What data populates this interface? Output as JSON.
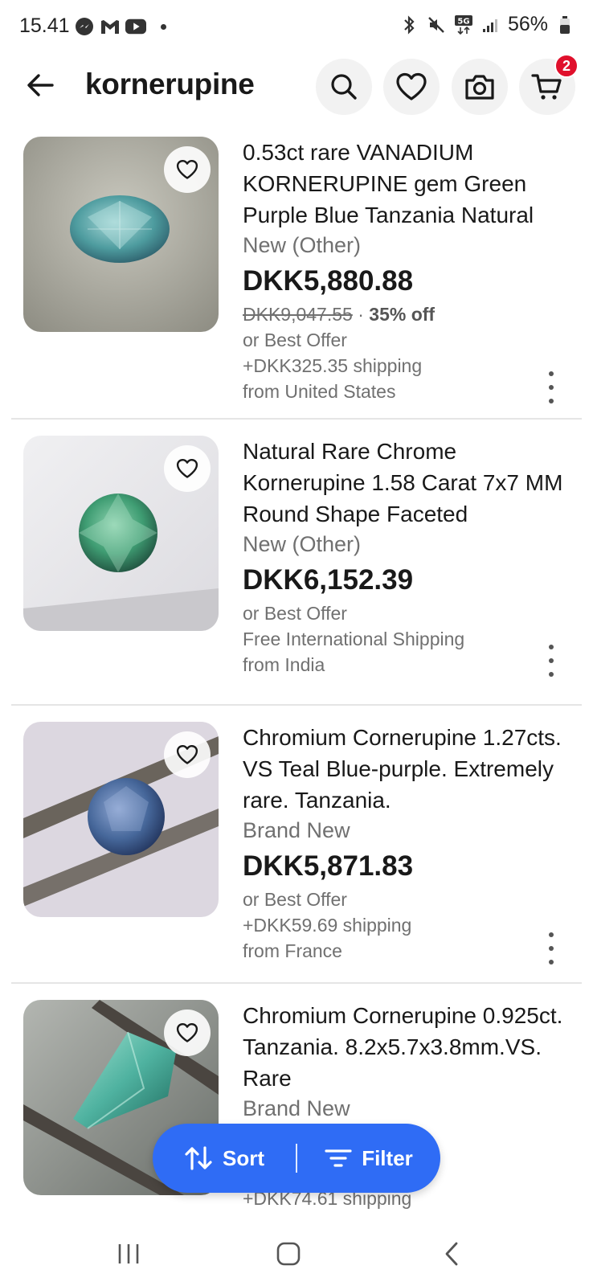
{
  "status_bar": {
    "time": "15.41",
    "battery": "56%",
    "network": "5G"
  },
  "header": {
    "query": "kornerupine",
    "cart_count": "2"
  },
  "listings": [
    {
      "title": "0.53ct rare VANADIUM KORNERUPINE gem Green Purple Blue Tanzania Natural",
      "condition": "New (Other)",
      "price": "DKK5,880.88",
      "original_price": "DKK9,047.55",
      "separator": "·",
      "discount": "35% off",
      "offer": "or Best Offer",
      "shipping": "+DKK325.35 shipping",
      "location": "from United States",
      "image_colors": {
        "bg": "#b9b8ad",
        "gem": "#4e9c9f"
      }
    },
    {
      "title": "Natural Rare Chrome Kornerupine 1.58 Carat 7x7 MM Round Shape Faceted",
      "condition": "New (Other)",
      "price": "DKK6,152.39",
      "offer": "or Best Offer",
      "shipping": "Free International Shipping",
      "location": "from India",
      "image_colors": {
        "bg": "#e9e8ea",
        "gem": "#3f9d73"
      }
    },
    {
      "title": "Chromium Cornerupine 1.27cts. VS Teal Blue-purple. Extremely rare. Tanzania.",
      "condition": "Brand New",
      "price": "DKK5,871.83",
      "offer": "or Best Offer",
      "shipping": "+DKK59.69 shipping",
      "location": "from France",
      "image_colors": {
        "bg": "#dcd7e0",
        "gem": "#46679a"
      }
    },
    {
      "title": "Chromium Cornerupine 0.925ct. Tanzania. 8.2x5.7x3.8mm.VS. Rare",
      "condition": "Brand New",
      "shipping": "+DKK74.61 shipping",
      "image_colors": {
        "bg": "#8a8f8a",
        "gem": "#4fb2a0"
      }
    }
  ],
  "toolbar": {
    "sort_label": "Sort",
    "filter_label": "Filter"
  },
  "colors": {
    "accent": "#2f6cf5",
    "badge": "#e0102c",
    "text_secondary": "#707070"
  }
}
